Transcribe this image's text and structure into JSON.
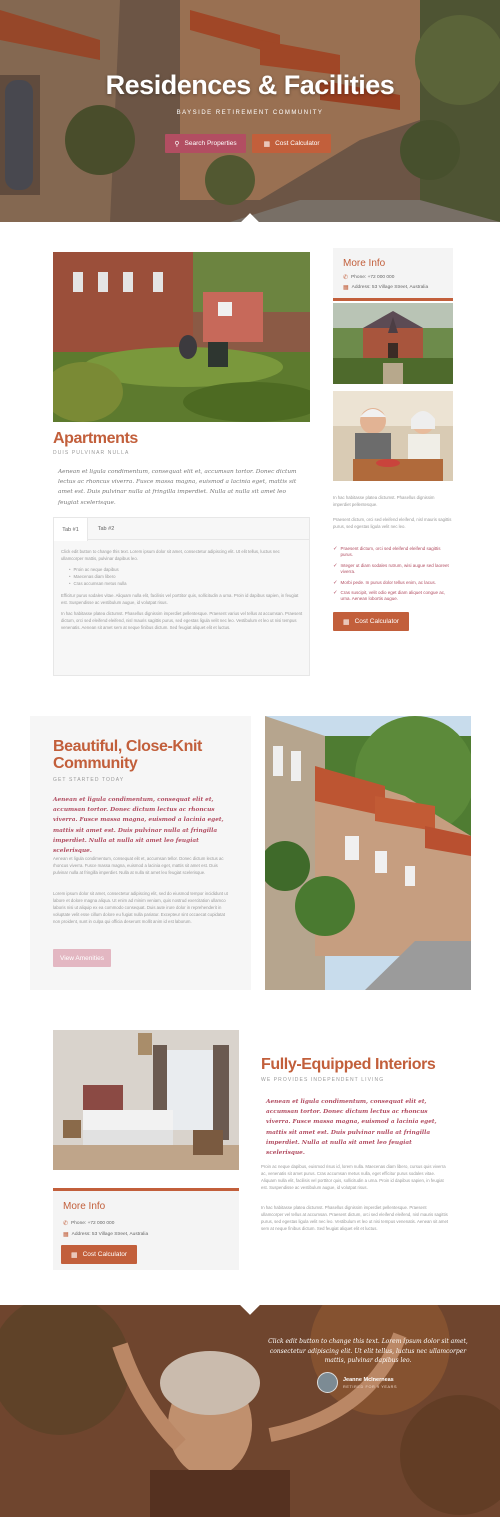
{
  "hero": {
    "title": "Residences & Facilities",
    "subtitle": "BAYSIDE RETIREMENT COMMUNITY",
    "search_button": "Search Properties",
    "calc_button": "Cost Calculator"
  },
  "apartments": {
    "title": "Apartments",
    "subtitle": "DUIS PULVINAR NULLA",
    "quote": "Aenean et ligula condimentum, consequat elit et, accumsan tortor. Donec dictum lectus ac rhoncus viverra. Fusce massa magna, euismod a lacinia eget, mattis sit amet est. Duis pulvinar nulla at fringilla imperdiet. Nulla at nulla sit amet leo feugiat scelerisque.",
    "tabs": [
      "Tab #1",
      "Tab #2"
    ],
    "tab_intro": "Click edit button to change this text. Lorem ipsum dolor sit amet, consectetur adipiscing elit. Ut elit tellus, luctus nec ullamcorper mattis, pulvinar dapibus leo.",
    "tab_list": [
      "Proin ac neque dapibus",
      "Maecenas diam libero",
      "Cras accumsan metus nulla"
    ],
    "tab_p2": "Efficitur purus sodales vitae. Aliquam nulla elit, facilisis vel porttitor quis, sollicitudin a urna. Proin id dapibus sapien, in feugiat est. Suspendisse ac vestibulum augue, id volutpat risus.",
    "tab_p3": "In hac habitasse platea dictumst. Phasellus dignissim imperdiet pellentesque. Praesent varius vel tellus at accumsan. Praesent dictum, orci sed eleifend eleifend, nisl mauris sagittis purus, sed egestas ligula velit nec leo. Vestibulum et leo ut nisi tempus venenatis. Aenean sit amet sem at neque finibus dictum. Sed feugiat aliquet elit et luctus."
  },
  "more_info": {
    "title": "More Info",
    "phone": "Phone: +72 000 000",
    "address": "Address: 53 Village Street, Australia",
    "calc_button": "Cost Calculator"
  },
  "sidebar": {
    "p1": "In hac habitasse platea dictumst. Phasellus dignissim imperdiet pellentesque.",
    "p2": "Praesent dictum, orci sed eleifend eleifend, nisl mauris sagittis purus, sed egestas ligula velit nec leo.",
    "checks": [
      "Praesent dictum, orci sed eleifend eleifend sagittis purus.",
      "Integer ut diam sodales rutrum, wisi augue sed laoreet viverra.",
      "Morbi pede. In purus dolor tellus enim, ac lacus.",
      "Cras suscipit, velit odio eget diam aliquet congue ac, urna. Aenean lobortis augue."
    ],
    "calc_button": "Cost Calculator"
  },
  "community": {
    "title": "Beautiful, Close-Knit Community",
    "subtitle": "GET STARTED TODAY",
    "quote": "Aenean et ligula condimentum, consequat elit et, accumsan tortor. Donec dictum lectus ac rhoncus viverra. Fusce massa magna, euismod a lacinia eget, mattis sit amet est. Duis pulvinar nulla at fringilla imperdiet. Nulla at nulla sit amet leo feugiat scelerisque.",
    "p1": "Aenean et ligula condimentum, consequat elit et, accumsan tellor. Donec dictum lectus ac rhoncus viverra. Fusce massa magna, euismod a lacinia eget, mattis sit amet est. Duis pulvinar nulla at fringilla imperdiet. Nulla at nulla sit amet leo feugiat scelerisque.",
    "p2": "Lorem ipsum dolor sit amet, consectetur adipiscing elit, sed do eiusmod tempor incididunt ut labore et dolore magna aliqua. Ut enim ad minim veniam, quis nostrud exercitation ullamco laboris nisi ut aliquip ex ea commodo consequat. Duis aute irure dolor in reprehenderit in voluptate velit esse cillum dolore eu fugiat nulla pariatur. Excepteur sint occaecat cupidatat non proident, sunt in culpa qui officia deserunt mollit anim id est laborum.",
    "button": "View Amenities"
  },
  "interiors": {
    "title": "Fully-Equipped Interiors",
    "subtitle": "WE PROVIDES INDEPENDENT LIVING",
    "quote": "Aenean et ligula condimentum, consequat elit et, accumsan tortor. Donec dictum lectus ac rhoncus viverra. Fusce massa magna, euismod a lacinia eget, mattis sit amet est. Duis pulvinar nulla at fringilla imperdiet. Nulla at nulla sit amet leo feugiat scelerisque.",
    "p1": "Proin ac neque dapibus, euismod risus id, lorem nulla. Maecenas diam libero, cursus quis viverra ac, venenatis sit amet purus. Cras accumsan metus nulla, eget efficitur purus sodales vitae. Aliquam nulla elit, facilisis vel porttitor quis, sollicitudin a urna. Proin id dapibus sapien, in feugiat est. Suspendisse ac vestibulum augue, id volutpat risus.",
    "p2": "In hac habitasse platea dictumst. Phasellus dignissim imperdiet pellentesque. Praesent ullamcorper vel tellus at accumsan. Praesent dictum, orci sed eleifend eleifend, nisl mauris sagittis purus, sed egestas ligula velit nec leo. Vestibulum et leo ut nisi tempus venenatis. Aenean sit amet sem at neque finibus dictum. Sed feugiat aliquet elit et luctus."
  },
  "testimonial": {
    "quote": "Click edit button to change this text. Lorem ipsum dolor sit amet, consectetur adipiscing elit. Ut elit tellus, luctus nec ullamcorper mattis, pulvinar dapibus leo.",
    "name": "Jeanne McInerneas",
    "role": "RETIRED FOR 9 YEARS"
  },
  "colors": {
    "accent": "#c25f3b",
    "rose": "#b24e62",
    "card_bg": "#f6f6f6"
  }
}
